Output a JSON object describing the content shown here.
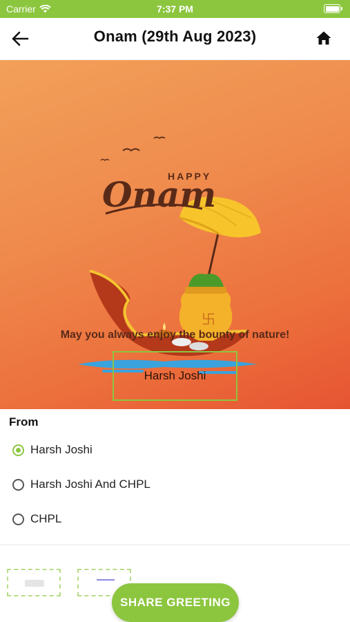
{
  "status_bar": {
    "carrier": "Carrier",
    "time": "7:37 PM"
  },
  "nav": {
    "title": "Onam (29th Aug 2023)",
    "back_icon": "arrow-left-icon",
    "home_icon": "home-icon"
  },
  "card": {
    "art_happy": "HAPPY",
    "art_title": "Onam",
    "message": "May you always enjoy the bounty of nature!",
    "sender_name": "Harsh Joshi"
  },
  "from": {
    "label": "From",
    "options": [
      {
        "label": "Harsh Joshi",
        "selected": true
      },
      {
        "label": "Harsh Joshi And CHPL",
        "selected": false
      },
      {
        "label": "CHPL",
        "selected": false
      }
    ]
  },
  "actions": {
    "share_label": "SHARE GREETING"
  },
  "colors": {
    "accent": "#8cc63f",
    "card_orange": "#ec6f3c"
  }
}
